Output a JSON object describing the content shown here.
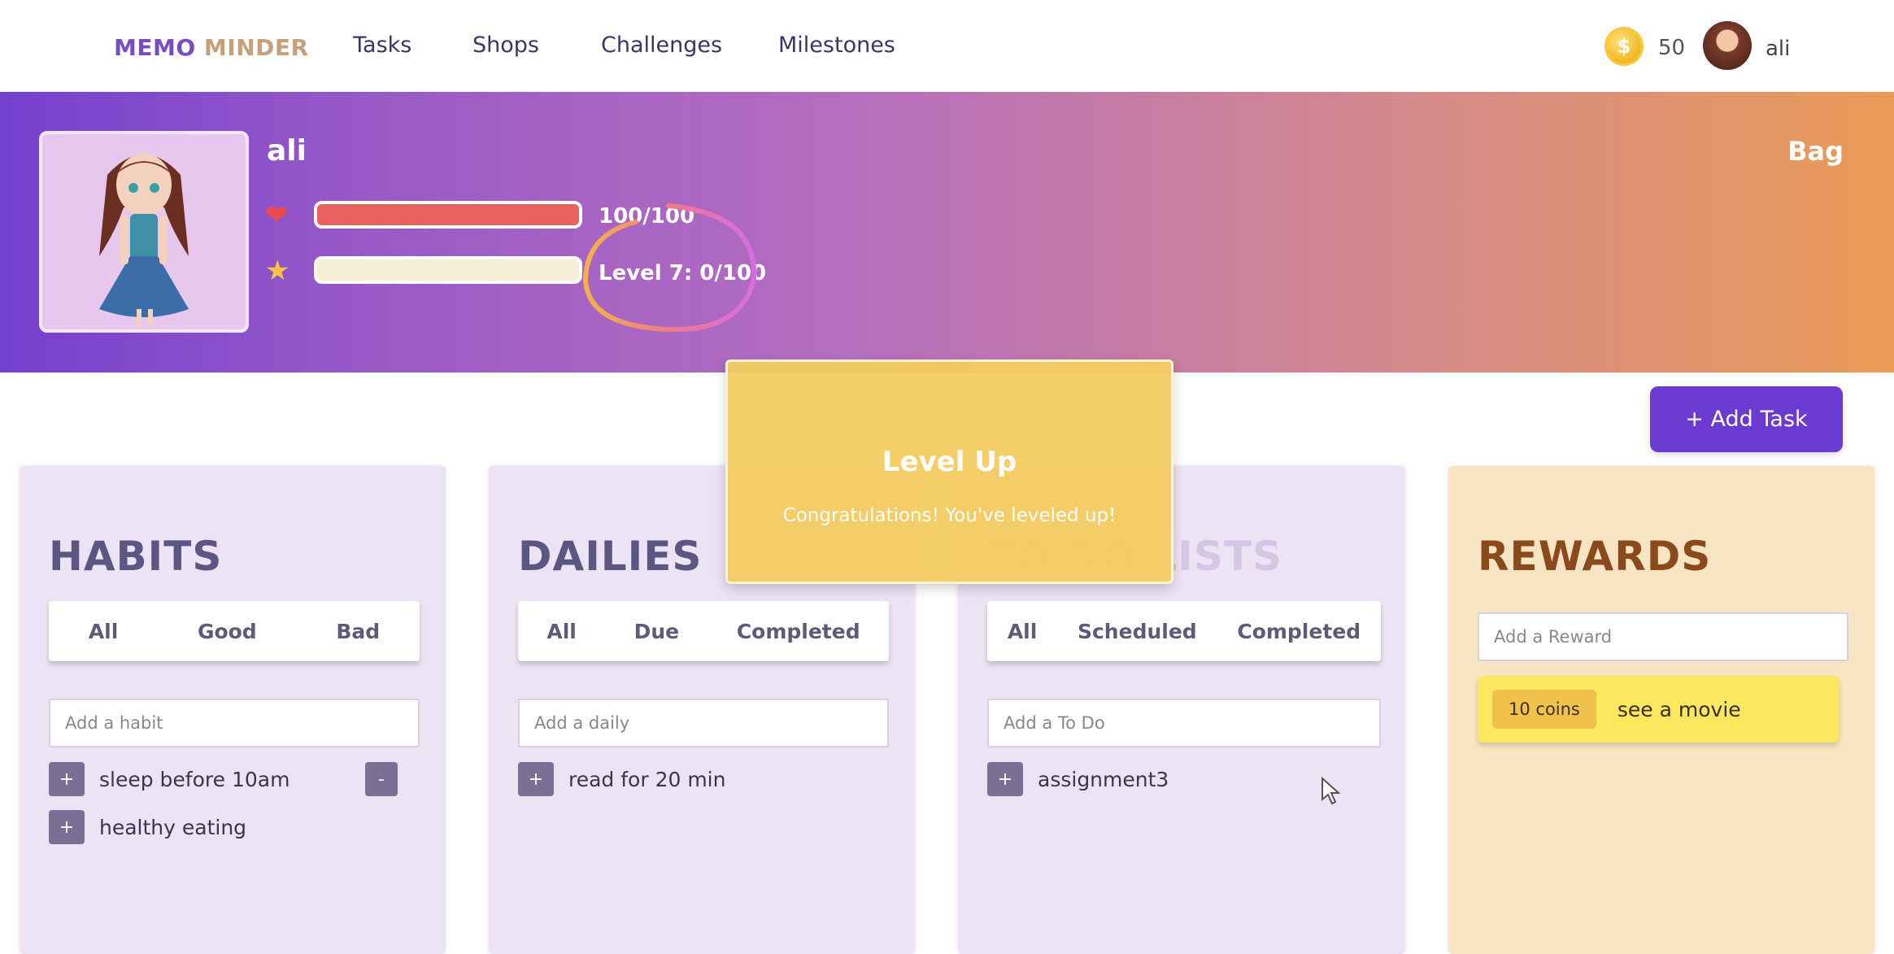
{
  "nav": {
    "logo_part1": "MEMO",
    "logo_part2": "MINDER",
    "links": [
      "Tasks",
      "Shops",
      "Challenges",
      "Milestones"
    ],
    "coins": "50",
    "user": "ali"
  },
  "profile": {
    "name": "ali",
    "health_text": "100/100",
    "health_fraction": 1.0,
    "xp_text": "Level 7: 0/100",
    "xp_fraction": 0.0,
    "bag_label": "Bag"
  },
  "add_task_label": "+ Add Task",
  "modal": {
    "title": "Level Up",
    "message": "Congratulations! You've leveled up!"
  },
  "habits": {
    "title": "HABITS",
    "filters": [
      "All",
      "Good",
      "Bad"
    ],
    "placeholder": "Add a habit",
    "items": [
      "sleep before 10am",
      "healthy eating"
    ]
  },
  "dailies": {
    "title": "DAILIES",
    "filters": [
      "All",
      "Due",
      "Completed"
    ],
    "placeholder": "Add a daily",
    "items": [
      "read for 20 min"
    ]
  },
  "todos": {
    "title": "TO DO LISTS",
    "filters": [
      "All",
      "Scheduled",
      "Completed"
    ],
    "placeholder": "Add a To Do",
    "items": [
      "assignment3"
    ]
  },
  "rewards": {
    "title": "REWARDS",
    "placeholder": "Add a Reward",
    "items": [
      {
        "cost": "10 coins",
        "label": "see a movie"
      }
    ]
  },
  "colors": {
    "accent": "#6b3ad0",
    "health": "#e86060",
    "xp": "#f7f0d6"
  }
}
